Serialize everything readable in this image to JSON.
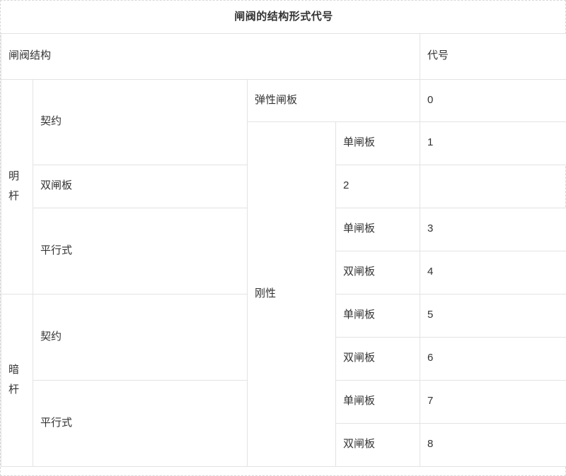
{
  "table": {
    "title": "闸阀的结构形式代号",
    "headers": {
      "structure": "闸阀结构",
      "code": "代号"
    },
    "stem_groups": [
      {
        "label": "明杆"
      },
      {
        "label": "暗杆"
      }
    ],
    "forms": {
      "contract": "契约",
      "parallel": "平行式"
    },
    "disc_types": {
      "elastic": "弹性闸板",
      "rigid": "刚性",
      "single": "单闸板",
      "double": "双闸板"
    },
    "rows": [
      {
        "stem": "明杆",
        "form": "契约",
        "rigidity": "",
        "plate": "弹性闸板",
        "code": "0"
      },
      {
        "stem": "明杆",
        "form": "契约",
        "rigidity": "刚性",
        "plate": "单闸板",
        "code": "1"
      },
      {
        "stem": "明杆",
        "form": "契约",
        "rigidity": "刚性",
        "plate": "双闸板",
        "code": "2"
      },
      {
        "stem": "明杆",
        "form": "平行式",
        "rigidity": "刚性",
        "plate": "单闸板",
        "code": "3"
      },
      {
        "stem": "明杆",
        "form": "平行式",
        "rigidity": "刚性",
        "plate": "双闸板",
        "code": "4"
      },
      {
        "stem": "暗杆",
        "form": "契约",
        "rigidity": "刚性",
        "plate": "单闸板",
        "code": "5"
      },
      {
        "stem": "暗杆",
        "form": "契约",
        "rigidity": "刚性",
        "plate": "双闸板",
        "code": "6"
      },
      {
        "stem": "暗杆",
        "form": "平行式",
        "rigidity": "刚性",
        "plate": "单闸板",
        "code": "7"
      },
      {
        "stem": "暗杆",
        "form": "平行式",
        "rigidity": "刚性",
        "plate": "双闸板",
        "code": "8"
      }
    ],
    "codes": [
      "0",
      "1",
      "2",
      "3",
      "4",
      "5",
      "6",
      "7",
      "8"
    ],
    "colors": {
      "border": "#e3e3e3",
      "outer_border": "#d8d8d8",
      "text": "#333333",
      "background": "#ffffff"
    }
  }
}
